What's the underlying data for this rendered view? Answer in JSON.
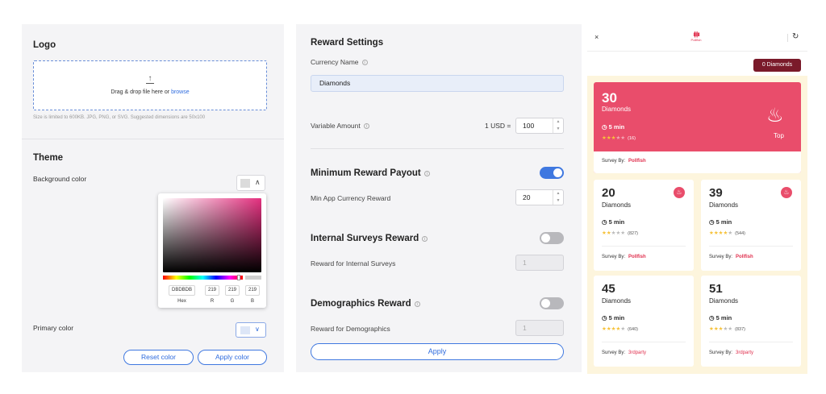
{
  "logo": {
    "title": "Logo",
    "upload_icon": "upload-arrow",
    "drop_text": "Drag & drop file here or ",
    "browse": "browse",
    "hint": "Size is limited to 600KB. JPG, PNG, or SVG. Suggested dimensions are 50x100"
  },
  "theme": {
    "title": "Theme",
    "background_label": "Background color",
    "primary_label": "Primary color",
    "reset_label": "Reset color",
    "apply_label": "Apply color",
    "picker": {
      "hex": "DBDBDB",
      "r": "219",
      "g": "219",
      "b": "219",
      "hex_label": "Hex",
      "r_label": "R",
      "g_label": "G",
      "b_label": "B"
    },
    "background_swatch": "#dbdbdb"
  },
  "rewards": {
    "title": "Reward Settings",
    "currency_label": "Currency Name",
    "currency_value": "Diamonds",
    "variable_label": "Variable Amount",
    "usd_label": "1 USD =",
    "usd_value": "100",
    "min_payout_title": "Minimum Reward Payout",
    "min_payout_label": "Min App Currency Reward",
    "min_payout_value": "20",
    "min_payout_enabled": true,
    "internal_title": "Internal Surveys Reward",
    "internal_label": "Reward for Internal Surveys",
    "internal_value": "1",
    "internal_enabled": false,
    "demo_title": "Demographics Reward",
    "demo_label": "Reward for Demographics",
    "demo_value": "1",
    "demo_enabled": false,
    "apply_label": "Apply"
  },
  "preview": {
    "close": "×",
    "brand": "Pollfish",
    "refresh": "↻",
    "balance": "0 Diamonds",
    "accent": "#e94d6b",
    "featured": {
      "amount": "30",
      "currency": "Diamonds",
      "time": "5 min",
      "rating": 3,
      "count": "(16)",
      "tag": "Top",
      "survey_by": "Survey By:",
      "provider": "Pollfish"
    },
    "cards": [
      {
        "amount": "20",
        "currency": "Diamonds",
        "time": "5 min",
        "rating": 2,
        "count": "(827)",
        "survey_by": "Survey By:",
        "provider": "Pollfish",
        "hot": true
      },
      {
        "amount": "39",
        "currency": "Diamonds",
        "time": "5 min",
        "rating": 4,
        "count": "(544)",
        "survey_by": "Survey By:",
        "provider": "Pollfish",
        "hot": true
      },
      {
        "amount": "45",
        "currency": "Diamonds",
        "time": "5 min",
        "rating": 4,
        "count": "(640)",
        "survey_by": "Survey By:",
        "provider": "3rdparty",
        "hot": false
      },
      {
        "amount": "51",
        "currency": "Diamonds",
        "time": "5 min",
        "rating": 3,
        "count": "(837)",
        "survey_by": "Survey By:",
        "provider": "3rdparty",
        "hot": false
      }
    ]
  }
}
